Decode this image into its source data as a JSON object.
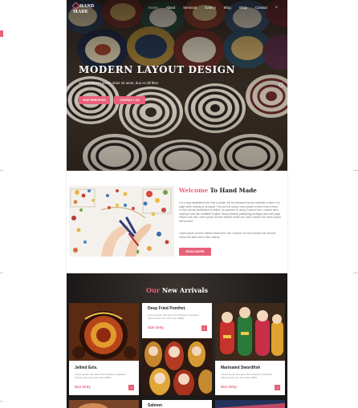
{
  "brand": {
    "line1": "HAND",
    "line2": "MADE"
  },
  "nav": {
    "items": [
      "Home",
      "About",
      "Services",
      "Gallery",
      "Blog",
      "Shop",
      "Contact"
    ],
    "active": "Home"
  },
  "hero": {
    "title": "MODERN LAYOUT DESIGN",
    "subtitle": "An investment ipsum dolor sit amet, duo et ulli flere",
    "buttons": [
      "OUR SERVICES",
      "CONTACT US"
    ]
  },
  "welcome": {
    "title_accent": "Welcome",
    "title_rest": " To Hand Made",
    "para1": "It is a long established fact that a reader will be distracted by the readable content of a page when looking at its layout. The point of using Lorem Ipsum is that it has a more-or-less normal distribution of letters, as opposed to using 'Content here, content here', making it look like readable English. Many desktop publishing packages and web page editors now use Lorem Ipsum as their default model text, and a search for 'lorem ipsum' will uncover.",
    "para2": "Lorem Ipsum as their default model text, and a search for lorem ipsum will uncover many web sites still in their infancy.",
    "button": "READ MORE"
  },
  "arrivals": {
    "title_accent": "Our",
    "title_rest": " New Arrivals",
    "cards": [
      {
        "name": "Jellied Eels.",
        "desc": "Lorem Ipsum has been the industry's standard dummy text ever since the 1500s.",
        "price": "$12 Only",
        "cart": "+"
      },
      {
        "name": "Deep Fried Pomfret.",
        "desc": "Lorem Ipsum has been the industry's standard dummy text ever since the 1500s.",
        "price": "$16 Only",
        "cart": "+"
      },
      {
        "name": "Marinated Swordfish",
        "desc": "Lorem Ipsum has been the industry's standard dummy text ever since the 1500s.",
        "price": "$12 Only",
        "cart": "+"
      },
      {
        "name": "Salmon",
        "desc": "",
        "price": "",
        "cart": ""
      }
    ]
  },
  "colors": {
    "accent": "#e8607a",
    "dark": "#1b1918"
  },
  "icons": [
    "search-icon",
    "logo-mark-icon",
    "cart-icon",
    "scroll-indicator-icon"
  ]
}
